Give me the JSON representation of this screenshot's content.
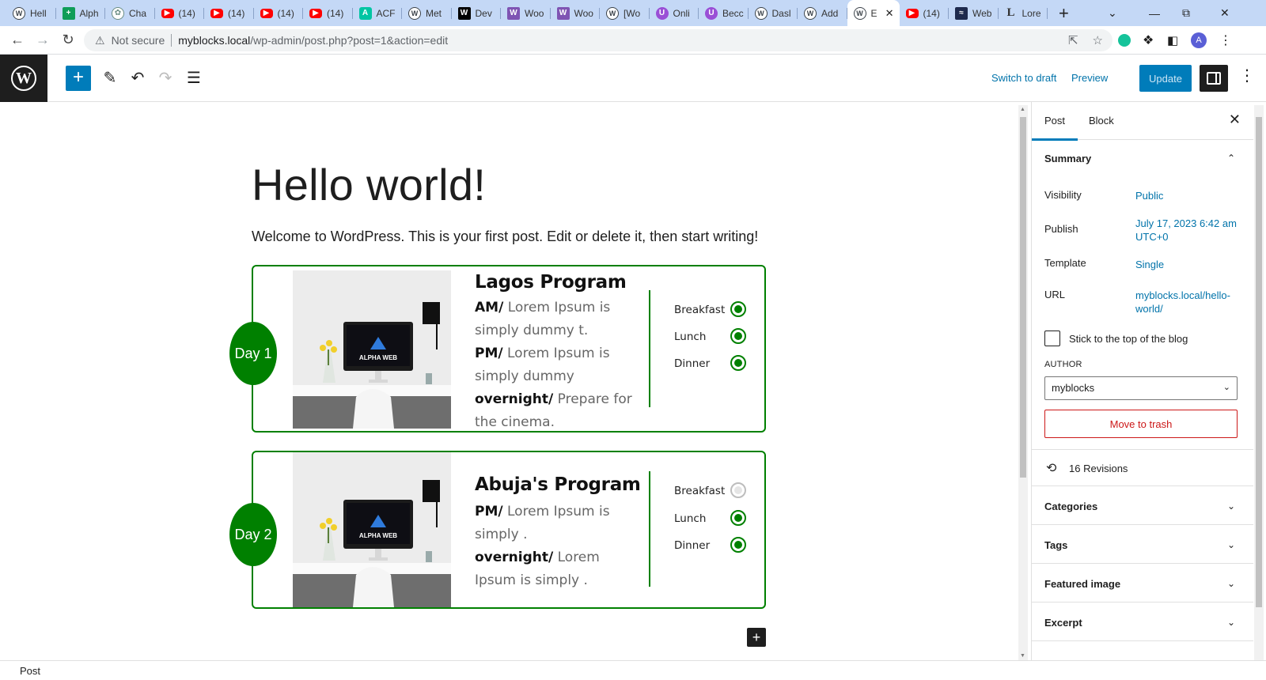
{
  "browser": {
    "tabs": [
      {
        "icon": "wordpress-icon",
        "label": "Hell"
      },
      {
        "icon": "sheets-icon",
        "label": "Alph"
      },
      {
        "icon": "chatgpt-icon",
        "label": "Cha"
      },
      {
        "icon": "youtube-icon",
        "label": "(14)"
      },
      {
        "icon": "youtube-icon",
        "label": "(14)"
      },
      {
        "icon": "youtube-icon",
        "label": "(14)"
      },
      {
        "icon": "youtube-icon",
        "label": "(14)"
      },
      {
        "icon": "acf-icon",
        "label": "ACF"
      },
      {
        "icon": "wordpress-icon",
        "label": "Met"
      },
      {
        "icon": "webdev-icon",
        "label": "Dev"
      },
      {
        "icon": "woo-icon",
        "label": "Woo"
      },
      {
        "icon": "woo-icon",
        "label": "Woo"
      },
      {
        "icon": "wordpress-icon",
        "label": "[Wo"
      },
      {
        "icon": "udemy-icon",
        "label": "Onli"
      },
      {
        "icon": "udemy-icon",
        "label": "Becc"
      },
      {
        "icon": "wordpress-icon",
        "label": "Dasl"
      },
      {
        "icon": "wordpress-icon",
        "label": "Add"
      },
      {
        "icon": "wordpress-icon",
        "label": "E",
        "active": true
      },
      {
        "icon": "youtube-icon",
        "label": "(14)"
      },
      {
        "icon": "elementor-icon",
        "label": "Web"
      },
      {
        "icon": "lorem-icon",
        "label": "Lore"
      }
    ],
    "new_tab": "+",
    "address": {
      "security": "Not secure",
      "host": "myblocks.local",
      "path": "/wp-admin/post.php?post=1&action=edit"
    },
    "profile_initial": "A"
  },
  "editor": {
    "header": {
      "switch_to_draft": "Switch to draft",
      "preview": "Preview",
      "update": "Update"
    },
    "post_title": "Hello world!",
    "intro_paragraph": "Welcome to WordPress. This is your first post. Edit or delete it, then start writing!",
    "cards": [
      {
        "day": "Day 1",
        "title": "Lagos Program",
        "photo_text": "ALPHA WEB",
        "body": [
          {
            "label": "AM/",
            "text": " Lorem Ipsum is simply dummy t."
          },
          {
            "label": "PM/",
            "text": " Lorem Ipsum is simply dummy"
          },
          {
            "label": "overnight/",
            "text": " Prepare for the cinema."
          }
        ],
        "meals": [
          {
            "name": "Breakfast",
            "checked": true
          },
          {
            "name": "Lunch",
            "checked": true
          },
          {
            "name": "Dinner",
            "checked": true
          }
        ]
      },
      {
        "day": "Day 2",
        "title": "Abuja's Program",
        "photo_text": "ALPHA WEB",
        "body": [
          {
            "label": "PM/",
            "text": " Lorem Ipsum is simply ."
          },
          {
            "label": "overnight/",
            "text": " Lorem Ipsum is simply ."
          }
        ],
        "meals": [
          {
            "name": "Breakfast",
            "checked": false
          },
          {
            "name": "Lunch",
            "checked": true
          },
          {
            "name": "Dinner",
            "checked": true
          }
        ]
      }
    ],
    "footer_breadcrumb": "Post"
  },
  "sidebar": {
    "tabs": [
      "Post",
      "Block"
    ],
    "summary": {
      "title": "Summary",
      "visibility_label": "Visibility",
      "visibility_value": "Public",
      "publish_label": "Publish",
      "publish_value": "July 17, 2023 6:42 am UTC+0",
      "template_label": "Template",
      "template_value": "Single",
      "url_label": "URL",
      "url_value": "myblocks.local/hello-world/",
      "sticky_label": "Stick to the top of the blog",
      "author_label": "AUTHOR",
      "author_value": "myblocks",
      "trash_label": "Move to trash"
    },
    "revisions": "16 Revisions",
    "panels": [
      "Categories",
      "Tags",
      "Featured image",
      "Excerpt"
    ]
  },
  "colors": {
    "accent": "#007cba",
    "card_green": "#008000",
    "trash_red": "#cc1818",
    "tab_strip": "#c4d8f6"
  }
}
